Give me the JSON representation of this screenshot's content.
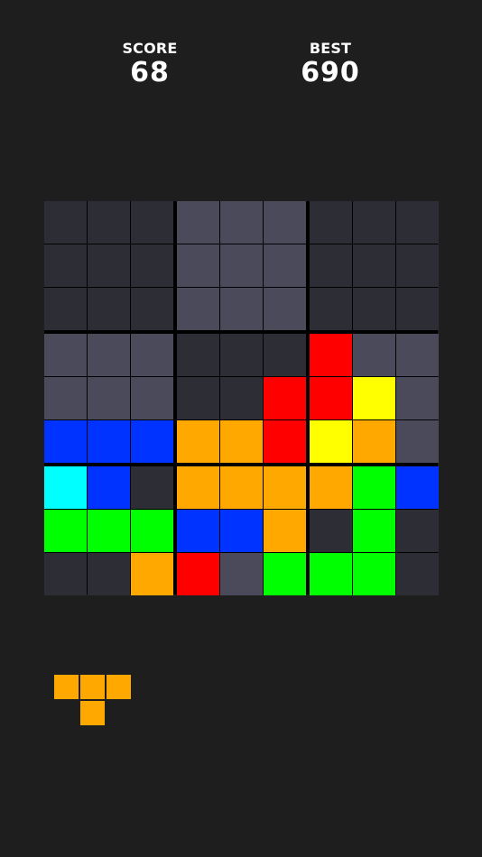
{
  "score": {
    "label": "SCORE",
    "value": "68"
  },
  "best": {
    "label": "BEST",
    "value": "690"
  },
  "colors": {
    "empty_dark": "#2d2d35",
    "empty_light": "#4a4a5a",
    "red": "#ff0000",
    "yellow": "#ffff00",
    "orange": "#ffa800",
    "blue": "#0033ff",
    "cyan": "#00ffff",
    "green": "#00ff00",
    "grid_line": "#000000"
  },
  "board": {
    "rows": [
      [
        "E",
        "E",
        "E",
        "L",
        "L",
        "L",
        "E",
        "E",
        "E"
      ],
      [
        "E",
        "E",
        "E",
        "L",
        "L",
        "L",
        "E",
        "E",
        "E"
      ],
      [
        "E",
        "E",
        "E",
        "L",
        "L",
        "L",
        "E",
        "E",
        "E"
      ],
      [
        "L",
        "L",
        "L",
        "E",
        "E",
        "E",
        "R",
        "L",
        "L"
      ],
      [
        "L",
        "L",
        "L",
        "E",
        "E",
        "R",
        "R",
        "Y",
        "L"
      ],
      [
        "B",
        "B",
        "B",
        "O",
        "O",
        "R",
        "Y",
        "O",
        "L"
      ],
      [
        "C",
        "B",
        "E",
        "O",
        "O",
        "O",
        "O",
        "G",
        "B"
      ],
      [
        "G",
        "G",
        "G",
        "B",
        "B",
        "O",
        "E",
        "G",
        "E"
      ],
      [
        "E",
        "E",
        "O",
        "R",
        "L",
        "G",
        "G",
        "G",
        "E"
      ]
    ]
  },
  "next_piece": {
    "color": "#ffa800",
    "cells": [
      [
        0,
        0
      ],
      [
        0,
        1
      ],
      [
        0,
        2
      ],
      [
        1,
        1
      ]
    ]
  }
}
